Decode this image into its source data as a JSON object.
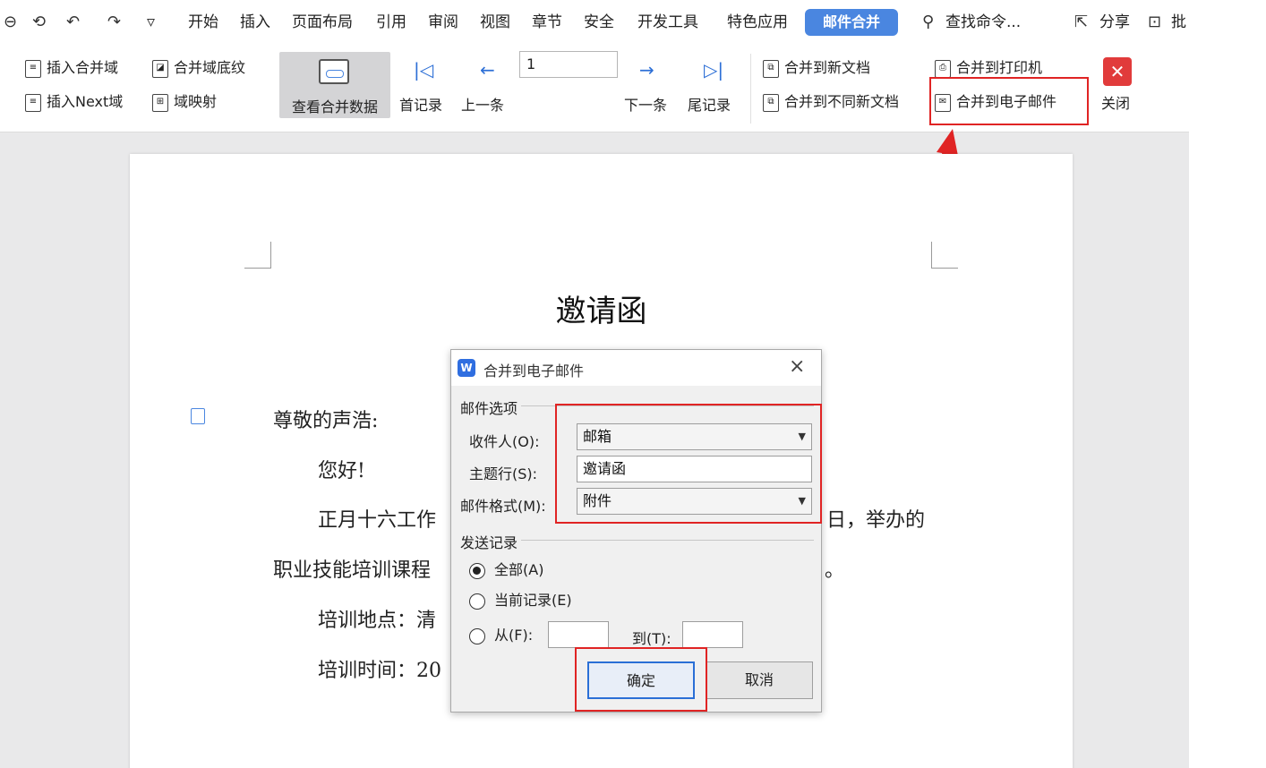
{
  "menubar": {
    "quick_icons": [
      "⊖",
      "⟲",
      "↶",
      "↷",
      "▿"
    ],
    "items": [
      "开始",
      "插入",
      "页面布局",
      "引用",
      "审阅",
      "视图",
      "章节",
      "安全",
      "开发工具",
      "特色应用"
    ],
    "active_tab": "邮件合并",
    "search_text": "查找命令...",
    "share_label": "分享",
    "comment_label": "批"
  },
  "ribbon": {
    "insert_merge_field": "插入合并域",
    "insert_next_field": "插入Next域",
    "merge_field_bottom": "合并域底纹",
    "field_mapping": "域映射",
    "view_merged_data": "查看合并数据",
    "first_record": "首记录",
    "prev_record": "上一条",
    "record_number": "1",
    "next_record": "下一条",
    "last_record": "尾记录",
    "merge_to_new_doc": "合并到新文档",
    "merge_to_different_docs": "合并到不同新文档",
    "merge_to_printer": "合并到打印机",
    "merge_to_email": "合并到电子邮件",
    "close_label": "关闭"
  },
  "document": {
    "title": "邀请函",
    "greeting": "尊敬的声浩:",
    "hello": "您好!",
    "para1_left": "正月十六工作",
    "para1_right": "日，举办的",
    "para2_left": "职业技能培训课程",
    "para2_right": "。",
    "location_label": "培训地点：清",
    "time_label": "培训时间：20"
  },
  "dialog": {
    "title": "合并到电子邮件",
    "group_mail_options": "邮件选项",
    "recipient_label": "收件人(O):",
    "recipient_value": "邮箱",
    "subject_label": "主题行(S):",
    "subject_value": "邀请函",
    "format_label": "邮件格式(M):",
    "format_value": "附件",
    "group_send_records": "发送记录",
    "radio_all": "全部(A)",
    "radio_current": "当前记录(E)",
    "radio_from": "从(F):",
    "to_label": "到(T):",
    "ok_label": "确定",
    "cancel_label": "取消"
  },
  "colors": {
    "accent_blue": "#4a86e0",
    "highlight_red": "#e02424",
    "close_red": "#e13b3b"
  },
  "icons": [
    "undo-icon",
    "redo-icon",
    "search-icon",
    "share-icon",
    "close-icon",
    "first-record-icon",
    "prev-record-icon",
    "next-record-icon",
    "last-record-icon",
    "wps-logo-icon",
    "dropdown-caret-icon"
  ]
}
